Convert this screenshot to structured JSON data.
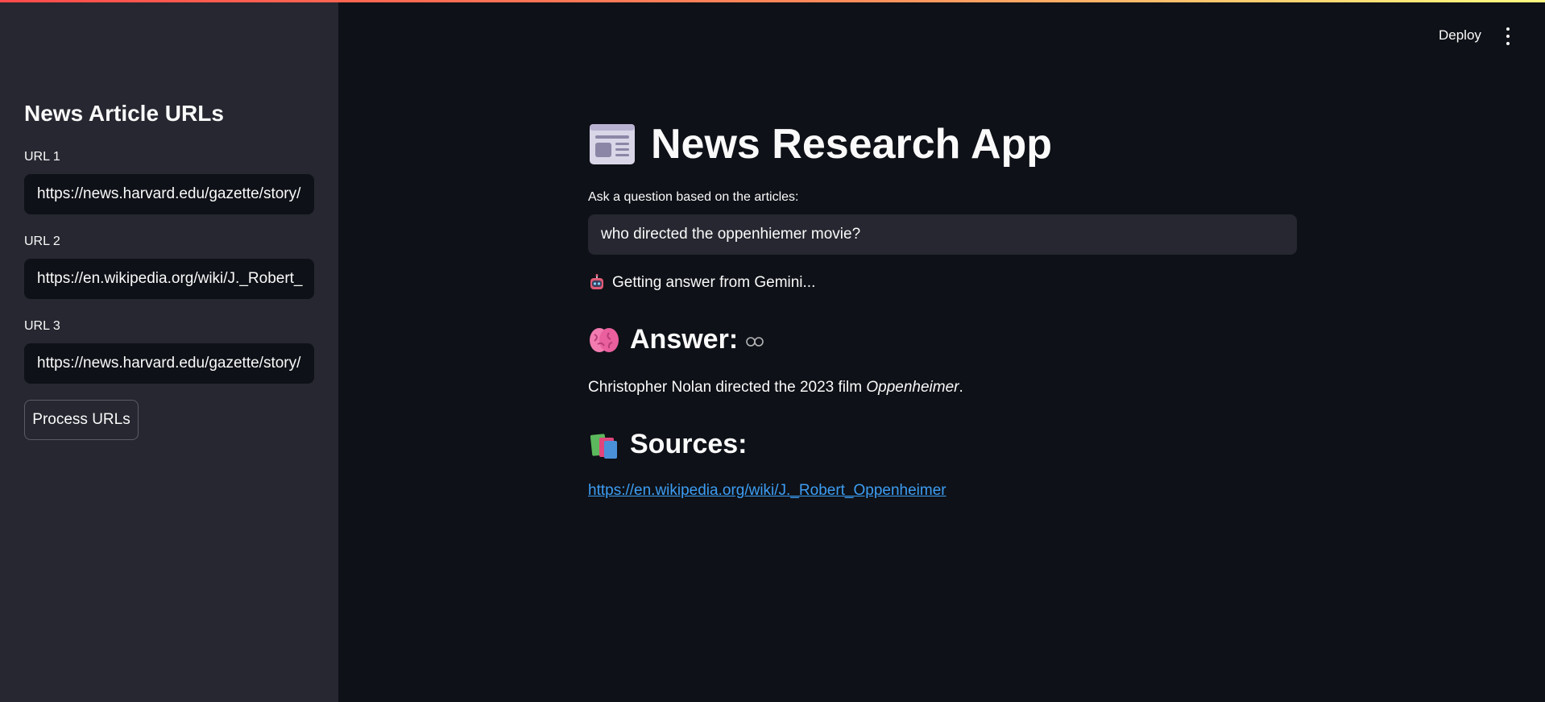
{
  "header": {
    "deploy_label": "Deploy",
    "menu_icon": "kebab-menu-icon"
  },
  "sidebar": {
    "title": "News Article URLs",
    "urls": [
      {
        "label": "URL 1",
        "value": "https://news.harvard.edu/gazette/story/"
      },
      {
        "label": "URL 2",
        "value": "https://en.wikipedia.org/wiki/J._Robert_"
      },
      {
        "label": "URL 3",
        "value": "https://news.harvard.edu/gazette/story/"
      }
    ],
    "process_label": "Process URLs"
  },
  "main": {
    "title_icon": "newspaper-icon",
    "title": "News Research App",
    "question_label": "Ask a question based on the articles:",
    "question_value": "who directed the oppenhiemer movie?",
    "status_icon": "robot-icon",
    "status_text": "Getting answer from Gemini...",
    "answer_icon": "brain-icon",
    "answer_heading": "Answer:",
    "answer_text_prefix": "Christopher Nolan directed the 2023 film ",
    "answer_text_italic": "Oppenheimer",
    "answer_text_suffix": ".",
    "sources_icon": "books-icon",
    "sources_heading": "Sources:",
    "source_link": "https://en.wikipedia.org/wiki/J._Robert_Oppenheimer"
  },
  "colors": {
    "background": "#0e1117",
    "sidebar": "#262730",
    "link": "#3d9df3",
    "accent": "#ff4b4b"
  }
}
